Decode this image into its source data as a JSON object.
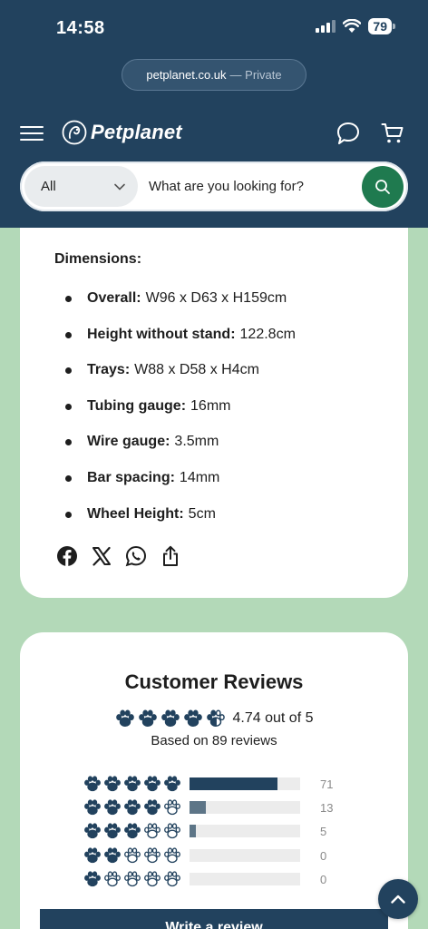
{
  "status": {
    "time": "14:58",
    "battery": "79"
  },
  "browser": {
    "domain": "petplanet.co.uk",
    "privacy": "— Private"
  },
  "header": {
    "logo_text": "Petplanet"
  },
  "search": {
    "category": "All",
    "placeholder": "What are you looking for?"
  },
  "dimensions": {
    "title": "Dimensions:",
    "items": [
      {
        "label": "Overall:",
        "value": "W96 x D63 x H159cm"
      },
      {
        "label": "Height without stand:",
        "value": "122.8cm"
      },
      {
        "label": "Trays:",
        "value": "W88 x D58 x H4cm"
      },
      {
        "label": "Tubing gauge:",
        "value": "16mm"
      },
      {
        "label": "Wire gauge:",
        "value": "3.5mm"
      },
      {
        "label": "Bar spacing:",
        "value": "14mm"
      },
      {
        "label": "Wheel Height:",
        "value": "5cm"
      }
    ]
  },
  "share": [
    "facebook-icon",
    "x-icon",
    "whatsapp-icon",
    "share-icon"
  ],
  "reviews": {
    "title": "Customer Reviews",
    "average_text": "4.74 out of 5",
    "average_rating": 4.74,
    "based_on": "Based on 89 reviews",
    "distribution": [
      {
        "stars": 5,
        "count": "71",
        "fraction": 0.798
      },
      {
        "stars": 4,
        "count": "13",
        "fraction": 0.146
      },
      {
        "stars": 3,
        "count": "5",
        "fraction": 0.056
      },
      {
        "stars": 2,
        "count": "0",
        "fraction": 0
      },
      {
        "stars": 1,
        "count": "0",
        "fraction": 0
      }
    ],
    "write_label": "Write a review"
  },
  "colors": {
    "navy": "#22425e",
    "green_button": "#1f7a4f",
    "page_background": "#b3d9b8",
    "bar_five_star": "#22425e",
    "bar_other": "#5d7587",
    "bar_track": "#ececec"
  }
}
